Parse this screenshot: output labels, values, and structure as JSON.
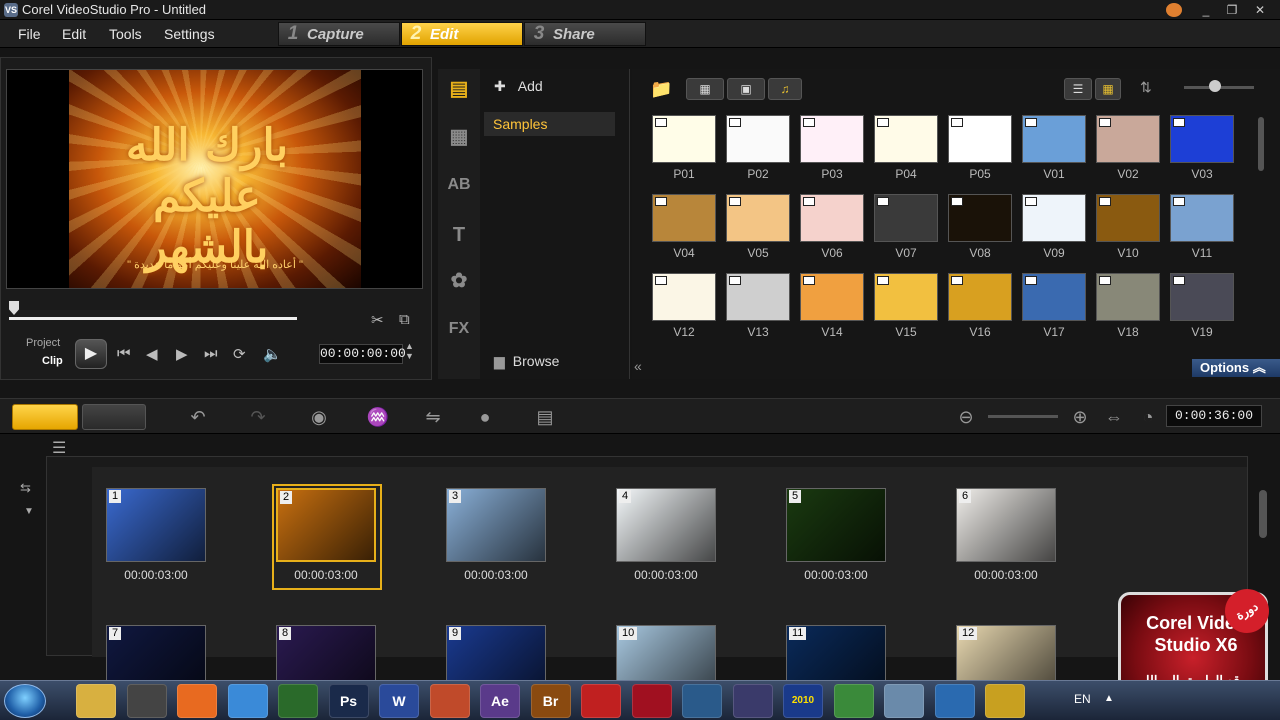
{
  "window": {
    "title": "Corel VideoStudio Pro - Untitled",
    "controls": [
      "minimize-icon",
      "restore-icon",
      "close-icon"
    ]
  },
  "menu": {
    "items": [
      "File",
      "Edit",
      "Tools",
      "Settings"
    ]
  },
  "steps": [
    {
      "num": "1",
      "label": "Capture",
      "active": false
    },
    {
      "num": "2",
      "label": "Edit",
      "active": true
    },
    {
      "num": "3",
      "label": "Share",
      "active": false
    }
  ],
  "player": {
    "preview_calligraphy": "بارك الله عليكم بالشهر",
    "preview_caption": "\" أعاده الله علينا وعليكم أعواماً عديدة \"",
    "mode_project": "Project",
    "mode_clip": "Clip",
    "timecode": "00:00:00:00"
  },
  "library": {
    "add_label": "Add",
    "folder": "Samples",
    "browse_label": "Browse",
    "options_label": "Options",
    "thumbs": [
      {
        "label": "P01",
        "color": "#fffde8"
      },
      {
        "label": "P02",
        "color": "#fafafa"
      },
      {
        "label": "P03",
        "color": "#fff0f8"
      },
      {
        "label": "P04",
        "color": "#fffbe8"
      },
      {
        "label": "P05",
        "color": "#ffffff"
      },
      {
        "label": "V01",
        "color": "#6a9fd8"
      },
      {
        "label": "V02",
        "color": "#c9a89a"
      },
      {
        "label": "V03",
        "color": "#1d3fd6"
      },
      {
        "label": "V04",
        "color": "#b8863a"
      },
      {
        "label": "V05",
        "color": "#f3c585"
      },
      {
        "label": "V06",
        "color": "#f5d2cc"
      },
      {
        "label": "V07",
        "color": "#3a3a3a"
      },
      {
        "label": "V08",
        "color": "#1a1208"
      },
      {
        "label": "V09",
        "color": "#eef4fa"
      },
      {
        "label": "V10",
        "color": "#8a5a10"
      },
      {
        "label": "V11",
        "color": "#7aa2d0"
      },
      {
        "label": "V12",
        "color": "#fbf6e6"
      },
      {
        "label": "V13",
        "color": "#cfcfcf"
      },
      {
        "label": "V14",
        "color": "#f0a040"
      },
      {
        "label": "V15",
        "color": "#f2c040"
      },
      {
        "label": "V16",
        "color": "#d8a020"
      },
      {
        "label": "V17",
        "color": "#3a6ab0"
      },
      {
        "label": "V18",
        "color": "#888878"
      },
      {
        "label": "V19",
        "color": "#4a4a56"
      }
    ]
  },
  "timeline": {
    "project_time": "0:00:36:00",
    "clips": [
      {
        "num": "1",
        "time": "00:00:03:00",
        "color": "#3a6ad0",
        "selected": false
      },
      {
        "num": "2",
        "time": "00:00:03:00",
        "color": "#c87010",
        "selected": true
      },
      {
        "num": "3",
        "time": "00:00:03:00",
        "color": "#8ab0d8",
        "selected": false
      },
      {
        "num": "4",
        "time": "00:00:03:00",
        "color": "#f4f8fa",
        "selected": false
      },
      {
        "num": "5",
        "time": "00:00:03:00",
        "color": "#1a3a10",
        "selected": false
      },
      {
        "num": "6",
        "time": "00:00:03:00",
        "color": "#f0eeea",
        "selected": false
      },
      {
        "num": "7",
        "time": "",
        "color": "#101840",
        "selected": false
      },
      {
        "num": "8",
        "time": "",
        "color": "#2a1a50",
        "selected": false
      },
      {
        "num": "9",
        "time": "",
        "color": "#1a3a90",
        "selected": false
      },
      {
        "num": "10",
        "time": "",
        "color": "#a8c8e0",
        "selected": false
      },
      {
        "num": "11",
        "time": "",
        "color": "#0a2a5a",
        "selected": false
      },
      {
        "num": "12",
        "time": "",
        "color": "#e8d8b0",
        "selected": false
      }
    ]
  },
  "taskbar": {
    "apps": [
      "explorer",
      "media",
      "firefox",
      "chrome",
      "excel-like",
      "Ps",
      "W",
      "ppt",
      "Ae",
      "Br",
      "flash",
      "red-app",
      "camera",
      "vsdc",
      "2010",
      "colorful",
      "settings",
      "arrow",
      "pen"
    ],
    "lang": "EN"
  },
  "badge": {
    "line1": "Corel Video",
    "line2": "Studio X6",
    "line3": "موقع الطريق إلى الله",
    "tag": "دورة"
  }
}
